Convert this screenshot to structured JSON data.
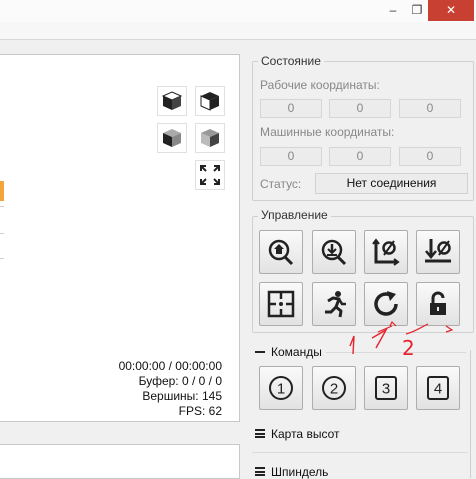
{
  "colors": {
    "accent": "#f3a43c",
    "annotation": "#e5232d",
    "close_button": "#c84031"
  },
  "window": {
    "minimize_icon": "minimize-icon",
    "restore_icon": "restore-icon",
    "close_icon": "close-icon",
    "minimize_glyph": "–",
    "restore_glyph": "❐",
    "close_glyph": "✕"
  },
  "viewport": {
    "view_buttons": [
      "cube-top-view",
      "cube-front-view",
      "cube-left-view",
      "cube-isometric-view"
    ],
    "fit_icon": "fullscreen-icon",
    "info": {
      "time": "00:00:00 / 00:00:00",
      "buffer": "Буфер: 0 / 0 / 0",
      "vertices": "Вершины: 145",
      "fps": "FPS: 62"
    }
  },
  "state": {
    "title": "Состояние",
    "work_coords_label": "Рабочие координаты:",
    "work_coords": [
      "0",
      "0",
      "0"
    ],
    "machine_coords_label": "Машинные координаты:",
    "machine_coords": [
      "0",
      "0",
      "0"
    ],
    "status_label": "Статус:",
    "status_value": "Нет соединения"
  },
  "control": {
    "title": "Управление",
    "buttons": [
      "home-search-icon",
      "zero-z-probe-icon",
      "zero-xy-icon",
      "zero-z-icon",
      "center-target-icon",
      "run-icon",
      "reset-icon",
      "unlock-icon"
    ]
  },
  "commands": {
    "title": "Команды",
    "buttons": [
      "1",
      "2",
      "3",
      "4"
    ]
  },
  "heightmap": {
    "title": "Карта высот"
  },
  "spindle": {
    "title": "Шпиндель"
  },
  "annotations": {
    "one": "1",
    "two": "2"
  }
}
